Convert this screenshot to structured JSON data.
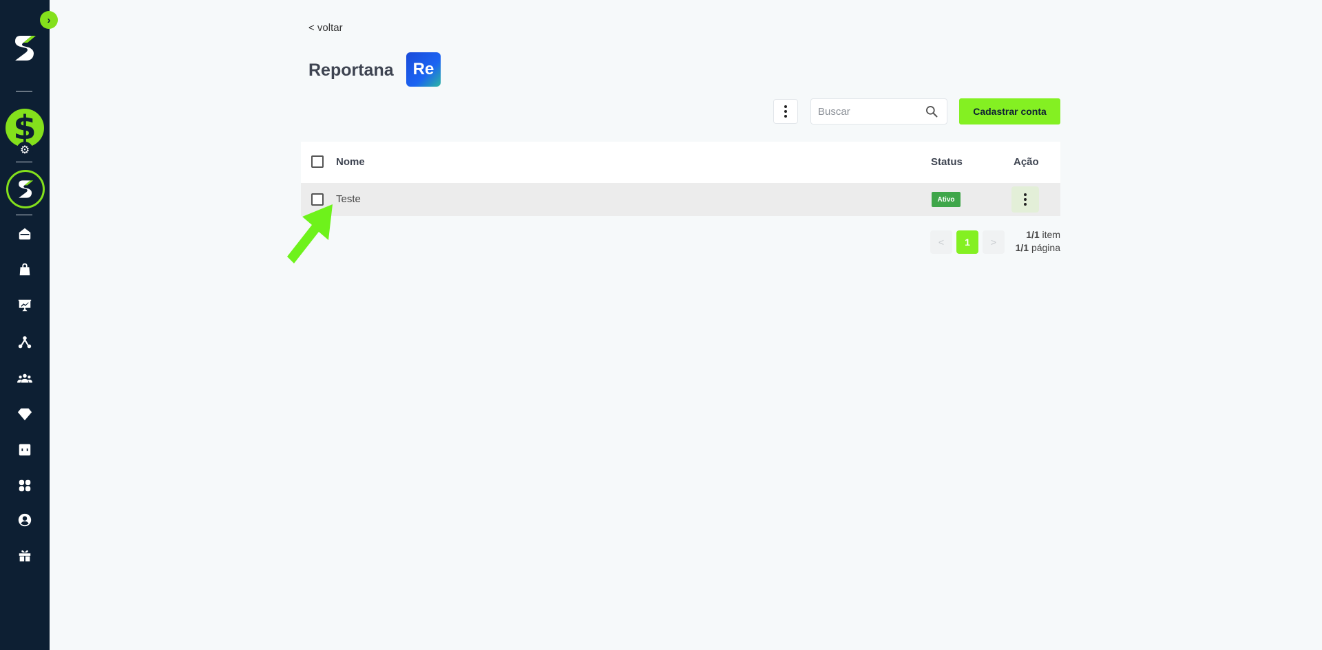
{
  "sidebar": {
    "expand_icon": "chevron-right-icon",
    "items": [
      {
        "name": "home",
        "icon": "home-icon"
      },
      {
        "name": "products",
        "icon": "shopping-bag-icon"
      },
      {
        "name": "sales",
        "icon": "presentation-chart-icon"
      },
      {
        "name": "affiliates",
        "icon": "network-icon"
      },
      {
        "name": "members",
        "icon": "users-icon"
      },
      {
        "name": "premium",
        "icon": "diamond-icon"
      },
      {
        "name": "finance",
        "icon": "wallet-icon"
      },
      {
        "name": "apps",
        "icon": "apps-grid-icon"
      },
      {
        "name": "profile",
        "icon": "user-circle-icon"
      },
      {
        "name": "rewards",
        "icon": "gift-icon"
      }
    ]
  },
  "header": {
    "back_label": "< voltar",
    "title": "Reportana",
    "app_logo_text": "Re"
  },
  "toolbar": {
    "search_placeholder": "Buscar",
    "search_value": "",
    "register_button": "Cadastrar conta"
  },
  "table": {
    "columns": {
      "name": "Nome",
      "status": "Status",
      "action": "Ação"
    },
    "rows": [
      {
        "name": "Teste",
        "status": "Ativo"
      }
    ]
  },
  "pagination": {
    "prev": "<",
    "current_page": "1",
    "next": ">",
    "items_count": "1/1",
    "items_label": "item",
    "pages_count": "1/1",
    "pages_label": "página"
  },
  "colors": {
    "accent": "#84f022",
    "sidebar_bg": "#0d1f33",
    "status_active": "#3fa64a"
  }
}
